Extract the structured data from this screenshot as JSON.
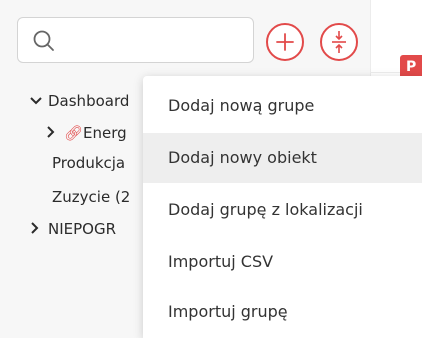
{
  "search": {
    "placeholder": "",
    "value": ""
  },
  "buttons": {
    "add_icon": "plus-circle-icon",
    "collapse_icon": "collapse-vertical-icon"
  },
  "tree": [
    {
      "label": "Dashboard",
      "expanded": true
    },
    {
      "label": "Energ",
      "has_link_icon": true
    },
    {
      "label": "Produkcja"
    },
    {
      "label": "Zuzycie (2"
    },
    {
      "label": "NIEPOGR"
    }
  ],
  "right_tab": {
    "label": "P"
  },
  "context_menu": {
    "items": [
      {
        "label": "Dodaj nową grupe"
      },
      {
        "label": "Dodaj nowy obiekt",
        "highlighted": true
      },
      {
        "label": "Dodaj grupę z lokalizacji"
      },
      {
        "label": "Importuj CSV"
      },
      {
        "label": "Importuj grupę"
      }
    ]
  },
  "colors": {
    "accent": "#e24a4a",
    "sidebar_bg": "#f7f7f7",
    "menu_hover": "#eeeeee"
  }
}
